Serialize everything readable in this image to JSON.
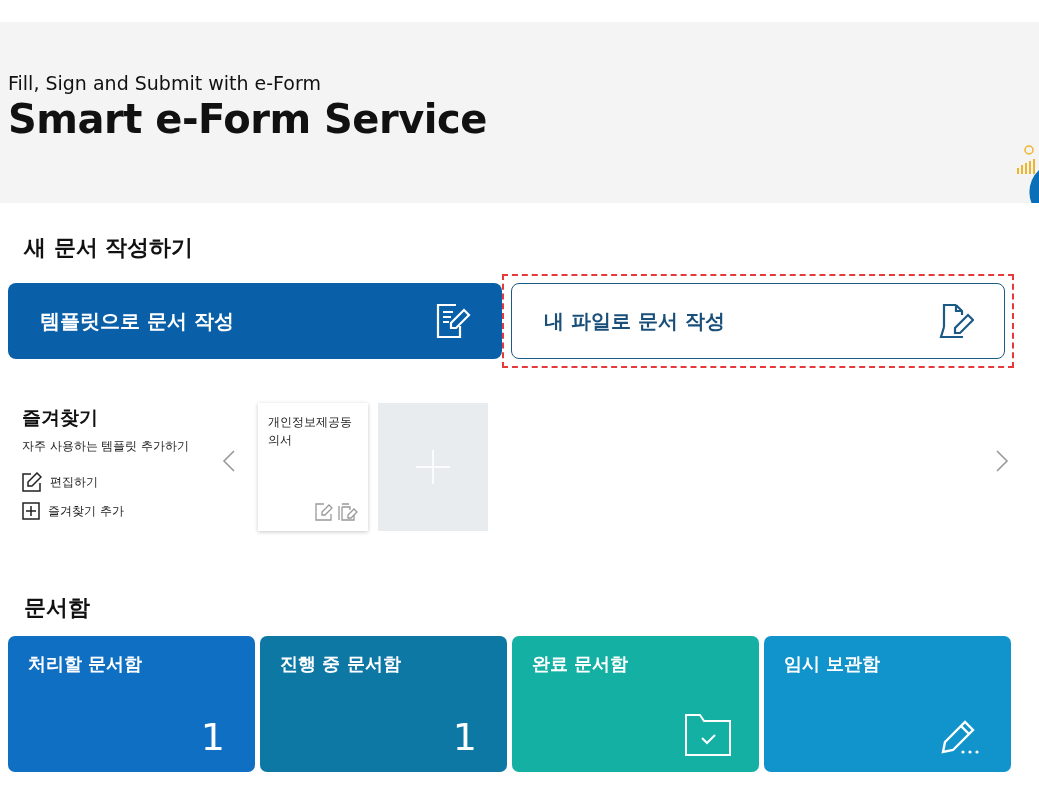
{
  "banner": {
    "subtitle": "Fill, Sign and Submit with e-Form",
    "title": "Smart e-Form Service"
  },
  "create": {
    "heading": "새 문서 작성하기",
    "buttons": [
      {
        "label": "템플릿으로 문서 작성",
        "kind": "template",
        "highlighted": false
      },
      {
        "label": "내 파일로 문서 작성",
        "kind": "file",
        "highlighted": true
      }
    ]
  },
  "favorites": {
    "title": "즐겨찾기",
    "description": "자주 사용하는 템플릿 추가하기",
    "actions": [
      {
        "label": "편집하기",
        "kind": "edit"
      },
      {
        "label": "즐겨찾기 추가",
        "kind": "add"
      }
    ],
    "cards": [
      {
        "title": "개인정보제공동의서"
      }
    ]
  },
  "boxes": {
    "heading": "문서함",
    "tiles": [
      {
        "title": "처리할 문서함",
        "kind": "count",
        "count": "1",
        "color": "#0f6fc2"
      },
      {
        "title": "진행 중 문서함",
        "kind": "count",
        "count": "1",
        "color": "#0e78a5"
      },
      {
        "title": "완료 문서함",
        "kind": "done",
        "color": "#14b0a3"
      },
      {
        "title": "임시 보관함",
        "kind": "draft",
        "color": "#1193cc"
      }
    ]
  }
}
